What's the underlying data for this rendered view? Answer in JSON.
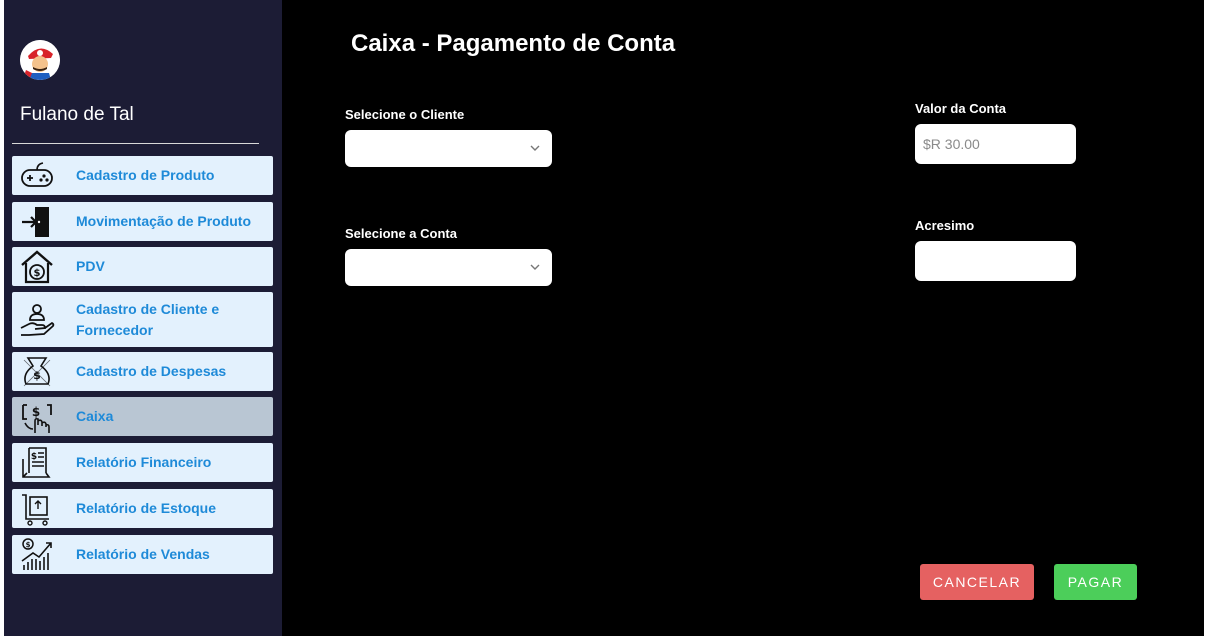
{
  "user": {
    "name": "Fulano de Tal"
  },
  "sidebar": {
    "items": [
      {
        "label": "Cadastro de Produto",
        "icon": "gamepad-icon"
      },
      {
        "label": "Movimentação de Produto",
        "icon": "door-enter-icon"
      },
      {
        "label": "PDV",
        "icon": "house-money-icon"
      },
      {
        "label": "Cadastro de Cliente e Fornecedor",
        "icon": "hand-person-icon"
      },
      {
        "label": "Cadastro de Despesas",
        "icon": "money-bag-hand-icon"
      },
      {
        "label": "Caixa",
        "icon": "cash-hand-icon"
      },
      {
        "label": "Relatório Financeiro",
        "icon": "financial-report-icon"
      },
      {
        "label": "Relatório de Estoque",
        "icon": "stock-cart-icon"
      },
      {
        "label": "Relatório de Vendas",
        "icon": "sales-chart-icon"
      }
    ],
    "active_index": 5
  },
  "main": {
    "title": "Caixa - Pagamento de Conta",
    "cliente_label": "Selecione o Cliente",
    "conta_label": "Selecione a Conta",
    "valor_label": "Valor da Conta",
    "valor_placeholder": "$R 30.00",
    "acresimo_label": "Acresimo",
    "acresimo_value": "",
    "cancel_label": "CANCELAR",
    "pay_label": "PAGAR"
  },
  "colors": {
    "sidebar_bg": "#1c1c35",
    "nav_bg": "#e3f1fd",
    "nav_active_bg": "#b9c6d3",
    "nav_text": "#1e8ad8",
    "cancel": "#e56161",
    "pay": "#4cce5a"
  }
}
